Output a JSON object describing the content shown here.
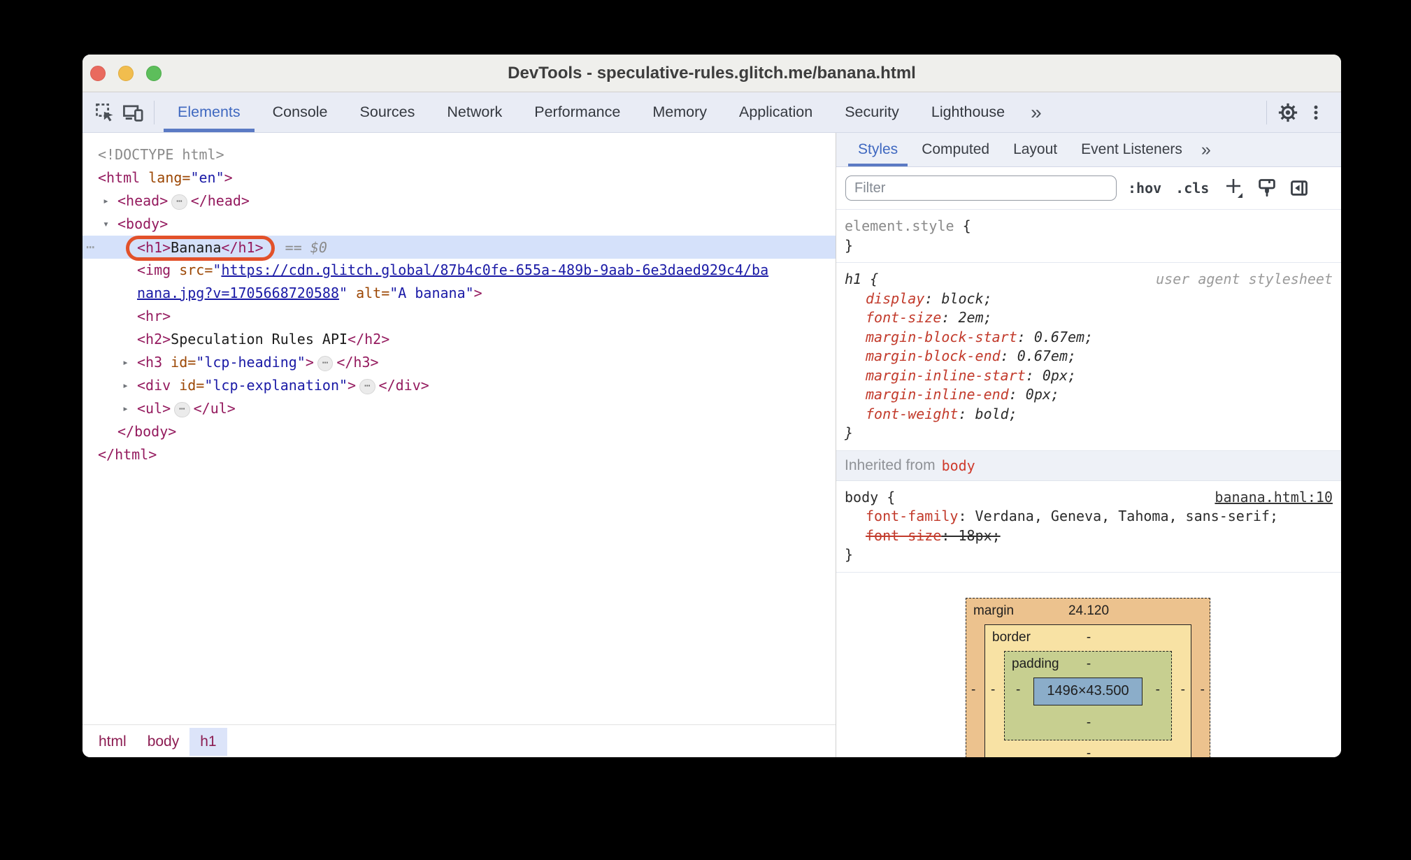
{
  "window": {
    "title": "DevTools - speculative-rules.glitch.me/banana.html"
  },
  "toolbar": {
    "tabs": [
      "Elements",
      "Console",
      "Sources",
      "Network",
      "Performance",
      "Memory",
      "Application",
      "Security",
      "Lighthouse"
    ],
    "active_tab": "Elements",
    "more_label": "»"
  },
  "dom_tree": {
    "lines": [
      {
        "indent": 0,
        "tokens": [
          {
            "t": "<!DOCTYPE html>",
            "c": "gray"
          }
        ]
      },
      {
        "indent": 0,
        "tokens": [
          {
            "t": "<html ",
            "c": "tag"
          },
          {
            "t": "lang=",
            "c": "attr"
          },
          {
            "t": "\"en\"",
            "c": "val"
          },
          {
            "t": ">",
            "c": "tag"
          }
        ]
      },
      {
        "indent": 1,
        "marker": "collapsed",
        "tokens": [
          {
            "t": "<head>",
            "c": "tag"
          },
          {
            "pill": true
          },
          {
            "t": "</head>",
            "c": "tag"
          }
        ]
      },
      {
        "indent": 1,
        "marker": "expanded",
        "tokens": [
          {
            "t": "<body>",
            "c": "tag"
          }
        ]
      },
      {
        "indent": 2,
        "selected": true,
        "gutter": true,
        "tokens": [
          {
            "ring": [
              {
                "t": "<h1>",
                "c": "tag"
              },
              {
                "t": "Banana",
                "c": "text"
              },
              {
                "t": "</h1>",
                "c": "tag"
              }
            ]
          },
          {
            "t": " == ",
            "c": "gray"
          },
          {
            "t": "$0",
            "c": "grayit"
          }
        ]
      },
      {
        "indent": 2,
        "tokens": [
          {
            "t": "<img ",
            "c": "tag"
          },
          {
            "t": "src=",
            "c": "attr"
          },
          {
            "t": "\"",
            "c": "val"
          },
          {
            "t": "https://cdn.glitch.global/87b4c0fe-655a-489b-9aab-6e3daed929c4/ba",
            "c": "link"
          }
        ]
      },
      {
        "indent": 2,
        "tokens": [
          {
            "t": "nana.jpg?v=1705668720588",
            "c": "link"
          },
          {
            "t": "\"",
            "c": "val"
          },
          {
            "t": " ",
            "c": "text"
          },
          {
            "t": "alt=",
            "c": "attr"
          },
          {
            "t": "\"A banana\"",
            "c": "val"
          },
          {
            "t": ">",
            "c": "tag"
          }
        ]
      },
      {
        "indent": 2,
        "tokens": [
          {
            "t": "<hr>",
            "c": "tag"
          }
        ]
      },
      {
        "indent": 2,
        "tokens": [
          {
            "t": "<h2>",
            "c": "tag"
          },
          {
            "t": "Speculation Rules API",
            "c": "text"
          },
          {
            "t": "</h2>",
            "c": "tag"
          }
        ]
      },
      {
        "indent": 2,
        "marker": "collapsed",
        "tokens": [
          {
            "t": "<h3 ",
            "c": "tag"
          },
          {
            "t": "id=",
            "c": "attr"
          },
          {
            "t": "\"lcp-heading\"",
            "c": "val"
          },
          {
            "t": ">",
            "c": "tag"
          },
          {
            "pill": true
          },
          {
            "t": "</h3>",
            "c": "tag"
          }
        ]
      },
      {
        "indent": 2,
        "marker": "collapsed",
        "tokens": [
          {
            "t": "<div ",
            "c": "tag"
          },
          {
            "t": "id=",
            "c": "attr"
          },
          {
            "t": "\"lcp-explanation\"",
            "c": "val"
          },
          {
            "t": ">",
            "c": "tag"
          },
          {
            "pill": true
          },
          {
            "t": "</div>",
            "c": "tag"
          }
        ]
      },
      {
        "indent": 2,
        "marker": "collapsed",
        "tokens": [
          {
            "t": "<ul>",
            "c": "tag"
          },
          {
            "pill": true
          },
          {
            "t": "</ul>",
            "c": "tag"
          }
        ]
      },
      {
        "indent": 1,
        "tokens": [
          {
            "t": "</body>",
            "c": "tag"
          }
        ]
      },
      {
        "indent": 0,
        "tokens": [
          {
            "t": "</html>",
            "c": "tag"
          }
        ]
      }
    ]
  },
  "breadcrumbs": {
    "items": [
      {
        "label": "html",
        "selected": false
      },
      {
        "label": "body",
        "selected": false
      },
      {
        "label": "h1",
        "selected": true
      }
    ]
  },
  "styles_panel": {
    "tabs": [
      "Styles",
      "Computed",
      "Layout",
      "Event Listeners"
    ],
    "active_tab": "Styles",
    "more_label": "»",
    "filter_placeholder": "Filter",
    "hov_label": ":hov",
    "cls_label": ".cls",
    "sections": [
      {
        "type": "rule",
        "italic": false,
        "lines": [
          {
            "cells": [
              {
                "t": "element.style ",
                "c": "gray"
              },
              {
                "t": "{",
                "c": "plain"
              }
            ]
          },
          {
            "cells": [
              {
                "t": "}",
                "c": "plain"
              }
            ]
          }
        ]
      },
      {
        "type": "rule",
        "italic": true,
        "lines": [
          {
            "cells": [
              {
                "t": "h1 {",
                "c": "plain"
              }
            ],
            "right": {
              "t": "user agent stylesheet",
              "c": "note"
            }
          },
          {
            "ind": true,
            "cells": [
              {
                "t": "display",
                "c": "prop"
              },
              {
                "t": ": block;",
                "c": "plain"
              }
            ]
          },
          {
            "ind": true,
            "cells": [
              {
                "t": "font-size",
                "c": "prop"
              },
              {
                "t": ": 2em;",
                "c": "plain"
              }
            ]
          },
          {
            "ind": true,
            "cells": [
              {
                "t": "margin-block-start",
                "c": "prop"
              },
              {
                "t": ": 0.67em;",
                "c": "plain"
              }
            ]
          },
          {
            "ind": true,
            "cells": [
              {
                "t": "margin-block-end",
                "c": "prop"
              },
              {
                "t": ": 0.67em;",
                "c": "plain"
              }
            ]
          },
          {
            "ind": true,
            "cells": [
              {
                "t": "margin-inline-start",
                "c": "prop"
              },
              {
                "t": ": 0px;",
                "c": "plain"
              }
            ]
          },
          {
            "ind": true,
            "cells": [
              {
                "t": "margin-inline-end",
                "c": "prop"
              },
              {
                "t": ": 0px;",
                "c": "plain"
              }
            ]
          },
          {
            "ind": true,
            "cells": [
              {
                "t": "font-weight",
                "c": "prop"
              },
              {
                "t": ": bold;",
                "c": "plain"
              }
            ]
          },
          {
            "cells": [
              {
                "t": "}",
                "c": "plain"
              }
            ]
          }
        ]
      },
      {
        "type": "header",
        "parts": [
          {
            "t": "Inherited from",
            "c": "hgray"
          },
          {
            "t": "body",
            "c": "hred"
          }
        ]
      },
      {
        "type": "rule",
        "italic": false,
        "lines": [
          {
            "cells": [
              {
                "t": "body {",
                "c": "plain"
              }
            ],
            "right": {
              "t": "banana.html:10",
              "c": "srclink"
            }
          },
          {
            "ind": true,
            "cells": [
              {
                "t": "font-family",
                "c": "prop"
              },
              {
                "t": ": Verdana, Geneva, Tahoma, sans-serif;",
                "c": "plain"
              }
            ]
          },
          {
            "ind": true,
            "struck": true,
            "cells": [
              {
                "t": "font-size",
                "c": "prop"
              },
              {
                "t": ": 18px;",
                "c": "plain"
              }
            ]
          },
          {
            "cells": [
              {
                "t": "}",
                "c": "plain"
              }
            ]
          }
        ]
      }
    ]
  },
  "box_model": {
    "margin_label": "margin",
    "margin_value": "24.120",
    "border_label": "border",
    "border_value": "-",
    "padding_label": "padding",
    "padding_value": "-",
    "content_value": "1496×43.500",
    "dash": "-"
  },
  "colors": {
    "selection_ring": "#e2512a",
    "selected_row": "#d5e1fa",
    "tag": "#941a5e",
    "attribute": "#9c4704",
    "value": "#1a1aa6",
    "property": "#c23a2b",
    "active_tab": "#3f68c0",
    "box_margin": "#ecc28e",
    "box_border": "#f8e2a4",
    "box_padding": "#c7cf90",
    "box_content": "#8badc9"
  }
}
